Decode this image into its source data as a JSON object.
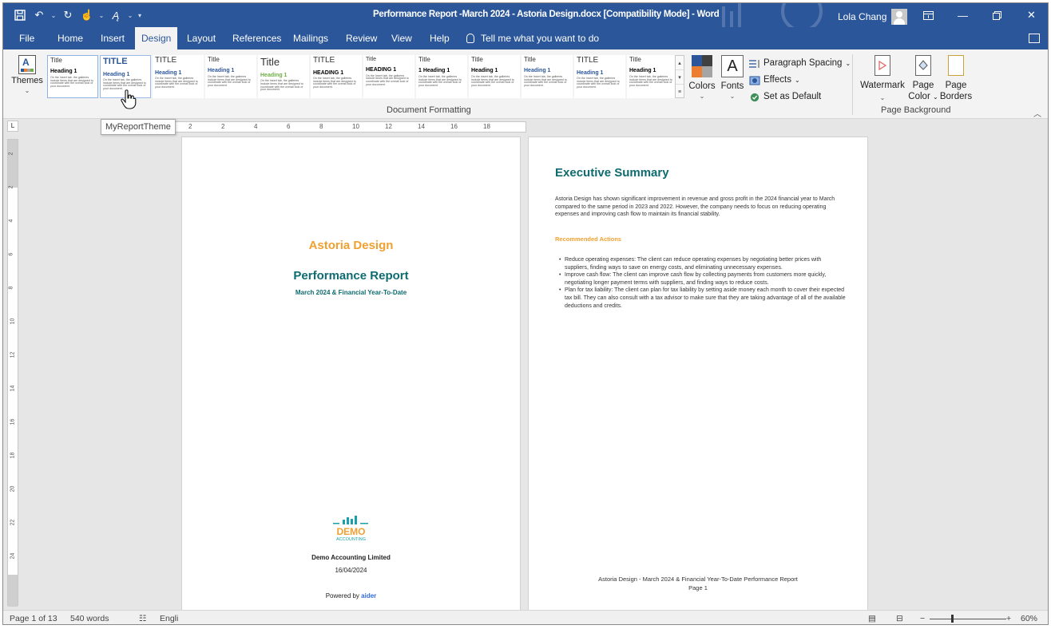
{
  "window": {
    "title": "Performance Report -March 2024 - Astoria Design.docx [Compatibility Mode] - Word",
    "user_name": "Lola Chang"
  },
  "tabs": [
    "File",
    "Home",
    "Insert",
    "Design",
    "Layout",
    "References",
    "Mailings",
    "Review",
    "View",
    "Help"
  ],
  "active_tab": "Design",
  "tell_me": "Tell me what you want to do",
  "ribbon": {
    "themes_label": "Themes",
    "style_set_labels": [
      "Title",
      "TITLE",
      "TITLE",
      "Title",
      "Title",
      "TITLE",
      "Title",
      "Title",
      "Title",
      "Title",
      "TITLE",
      "Title"
    ],
    "style_heading_labels": [
      "Heading 1",
      "Heading 1",
      "Heading 1",
      "Heading 1",
      "Heading 1",
      "HEADING 1",
      "HEADING 1",
      "1 Heading 1",
      "Heading 1",
      "Heading 1",
      "Heading 1",
      "Heading 1"
    ],
    "style_body_text": "On the Insert tab, the galleries include items that are designed to coordinate with the overall look of your document.",
    "document_formatting_label": "Document Formatting",
    "colors_label": "Colors",
    "fonts_label": "Fonts",
    "paragraph_spacing": "Paragraph Spacing",
    "effects": "Effects",
    "set_default": "Set as Default",
    "watermark": "Watermark",
    "page_color_1": "Page",
    "page_color_2": "Color",
    "page_borders_1": "Page",
    "page_borders_2": "Borders",
    "page_background_label": "Page Background",
    "tooltip": "MyReportTheme"
  },
  "ruler": {
    "h_ticks": [
      "2",
      "2",
      "4",
      "6",
      "8",
      "10",
      "12",
      "14",
      "16",
      "18"
    ],
    "v_ticks": [
      "2",
      "2",
      "4",
      "6",
      "8",
      "10",
      "12",
      "14",
      "16",
      "18",
      "20",
      "22",
      "24"
    ]
  },
  "page1": {
    "brand": "Astoria Design",
    "title": "Performance Report",
    "subtitle": "March 2024 & Financial Year-To-Date",
    "logo_text_1": "DEMO",
    "logo_text_2": "ACCOUNTING",
    "company": "Demo Accounting Limited",
    "date": "16/04/2024",
    "powered_by": "Powered by",
    "powered_brand": "aider"
  },
  "page2": {
    "heading": "Executive Summary",
    "paragraph": "Astoria Design has shown significant improvement in revenue and gross profit in the 2024 financial year to March compared to the same period in 2023 and 2022. However, the company needs to focus on reducing operating expenses and improving cash flow to maintain its financial stability.",
    "subheading": "Recommended Actions",
    "bullets": [
      "Reduce operating expenses: The client can reduce operating expenses by negotiating better prices with suppliers, finding ways to save on energy costs, and eliminating unnecessary expenses.",
      "Improve cash flow: The client can improve cash flow by collecting payments from customers more quickly, negotiating longer payment terms with suppliers, and finding ways to reduce costs.",
      "Plan for tax liability: The client can plan for tax liability by setting aside money each month to cover their expected tax bill. They can also consult with a tax advisor to make sure that they are taking advantage of all of the available deductions and credits."
    ],
    "footer_line": "Astoria Design - March 2024 & Financial Year-To-Date Performance Report",
    "footer_page": "Page 1"
  },
  "status": {
    "page_info": "Page 1 of 13",
    "words": "540 words",
    "language": "Engli",
    "zoom": "60%"
  },
  "colors": {
    "word_blue": "#2b579a",
    "teal": "#0e6b6f",
    "orange": "#f0a030"
  }
}
